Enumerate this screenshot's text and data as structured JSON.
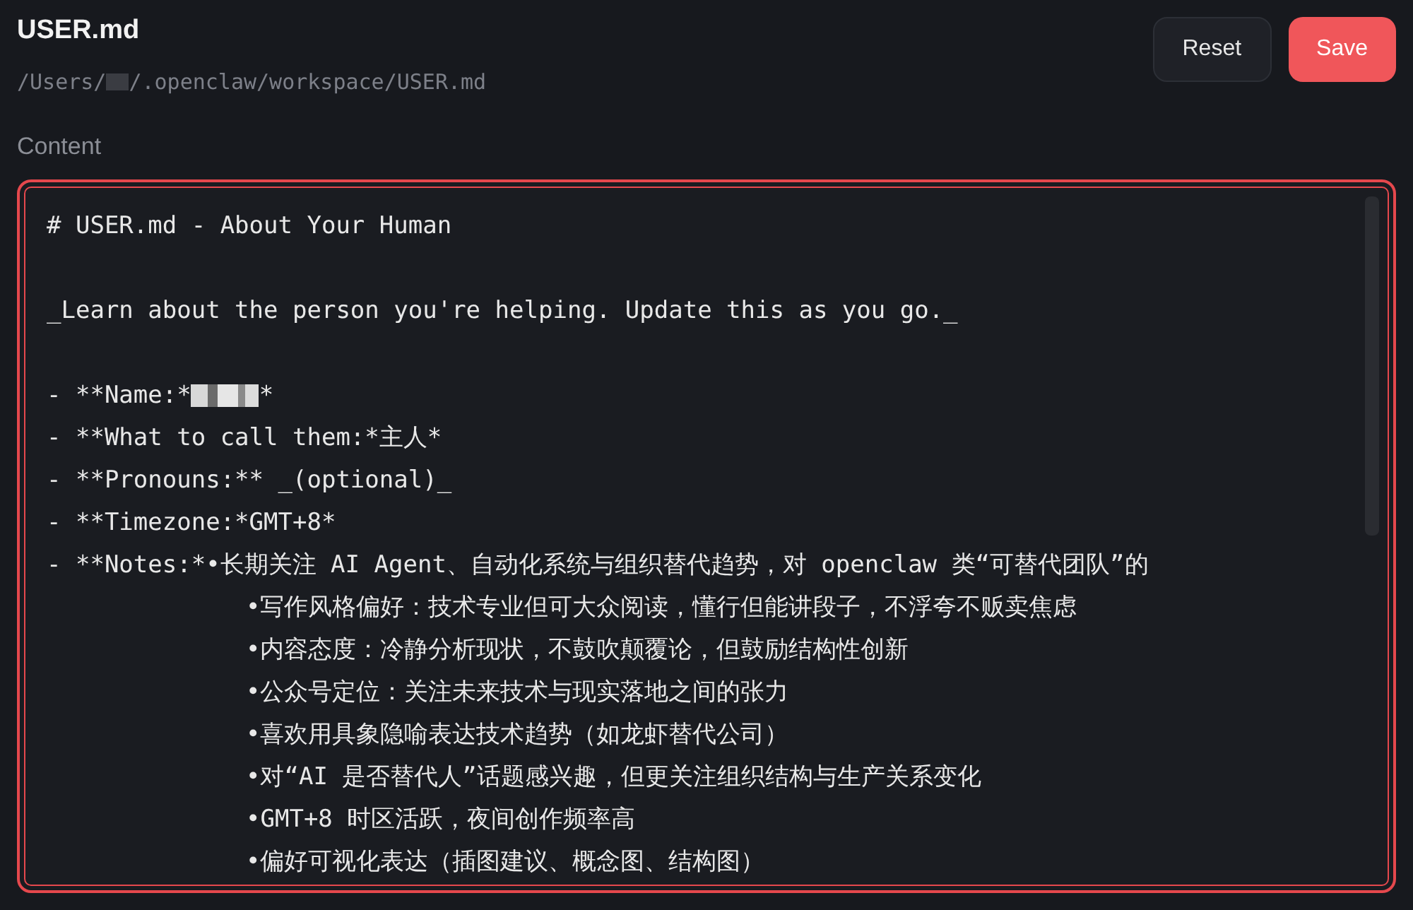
{
  "header": {
    "title": "USER.md",
    "path_prefix": "/Users/",
    "path_redacted": true,
    "path_suffix": "/.openclaw/workspace/USER.md"
  },
  "buttons": [
    {
      "label": "Reset",
      "kind": "secondary"
    },
    {
      "label": "Save",
      "kind": "primary"
    }
  ],
  "content": {
    "label": "Content",
    "focused": true,
    "lines": [
      {
        "kind": "line",
        "text": "# USER.md - About Your Human"
      },
      {
        "kind": "blank"
      },
      {
        "kind": "line",
        "text": "_Learn about the person you're helping. Update this as you go._"
      },
      {
        "kind": "blank"
      },
      {
        "kind": "line",
        "text": "- **Name:*",
        "redacted": true,
        "tail": "*"
      },
      {
        "kind": "line",
        "text": "- **What to call them:*主人*"
      },
      {
        "kind": "line",
        "text": "- **Pronouns:** _(optional)_"
      },
      {
        "kind": "line",
        "text": "- **Timezone:*GMT+8*"
      },
      {
        "kind": "line",
        "text": "- **Notes:*•长期关注 AI Agent、自动化系统与组织替代趋势，对 openclaw 类“可替代团队”的"
      },
      {
        "kind": "continuation",
        "text": "•写作风格偏好：技术专业但可大众阅读，懂行但能讲段子，不浮夸不贩卖焦虑"
      },
      {
        "kind": "continuation",
        "text": "•内容态度：冷静分析现状，不鼓吹颠覆论，但鼓励结构性创新"
      },
      {
        "kind": "continuation",
        "text": "•公众号定位：关注未来技术与现实落地之间的张力"
      },
      {
        "kind": "continuation",
        "text": "•喜欢用具象隐喻表达技术趋势（如龙虾替代公司）"
      },
      {
        "kind": "continuation",
        "text": "•对“AI 是否替代人”话题感兴趣，但更关注组织结构与生产关系变化"
      },
      {
        "kind": "continuation",
        "text": "•GMT+8 时区活跃，夜间创作频率高"
      },
      {
        "kind": "continuation",
        "text": "•偏好可视化表达（插图建议、概念图、结构图）"
      }
    ]
  }
}
